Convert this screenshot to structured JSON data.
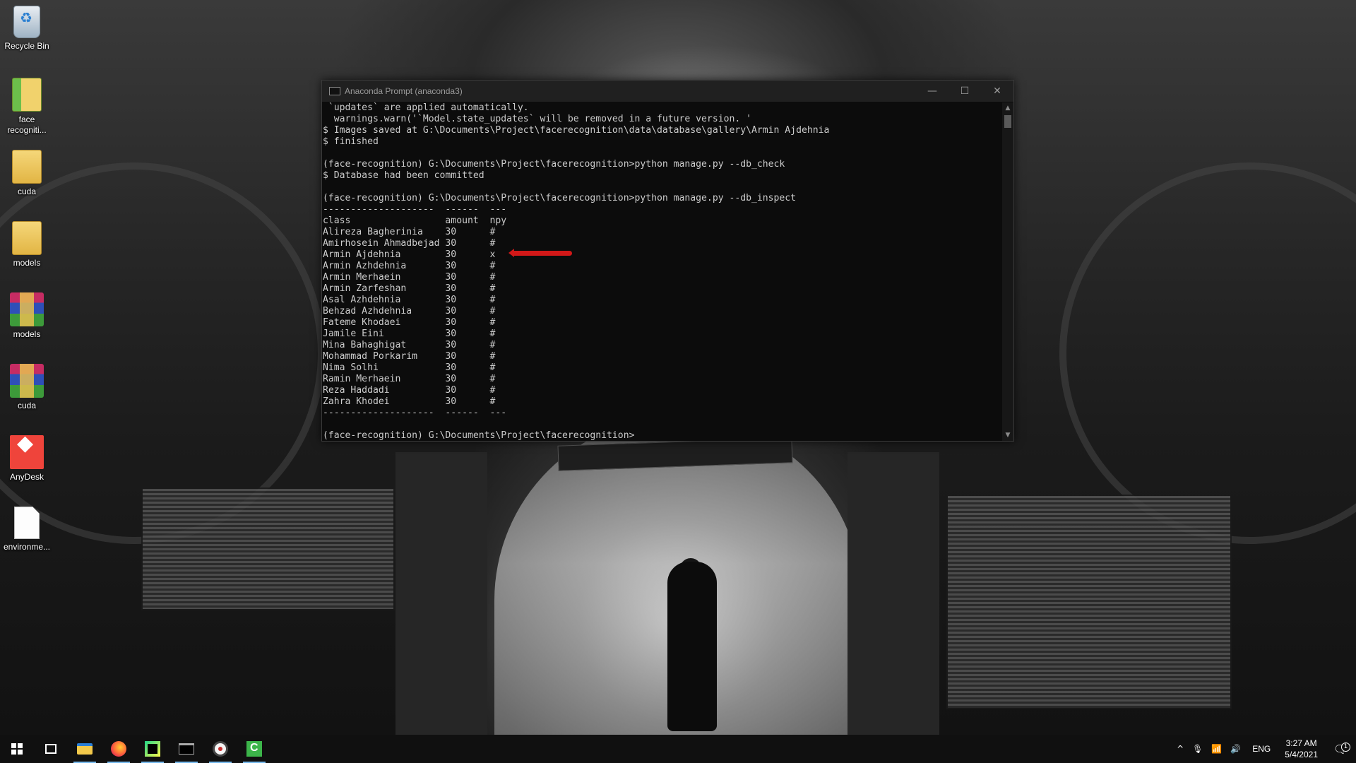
{
  "desktop": {
    "icons": [
      {
        "label": "Recycle Bin",
        "icon": "recycle-bin-icon"
      },
      {
        "label": "face\nrecogniti...",
        "icon": "folder-icon"
      },
      {
        "label": "cuda",
        "icon": "folder-icon"
      },
      {
        "label": "models",
        "icon": "folder-icon"
      },
      {
        "label": "models",
        "icon": "winrar-archive-icon"
      },
      {
        "label": "cuda",
        "icon": "winrar-archive-icon"
      },
      {
        "label": "AnyDesk",
        "icon": "anydesk-icon"
      },
      {
        "label": "environme...",
        "icon": "file-icon"
      }
    ]
  },
  "console": {
    "title": "Anaconda Prompt (anaconda3)",
    "controls": {
      "minimize": "—",
      "maximize": "☐",
      "close": "✕"
    },
    "lines": [
      " `updates` are applied automatically.",
      "  warnings.warn('`Model.state_updates` will be removed in a future version. '",
      "$ Images saved at G:\\Documents\\Project\\facerecognition\\data\\database\\gallery\\Armin Ajdehnia",
      "$ finished",
      "",
      "(face-recognition) G:\\Documents\\Project\\facerecognition>python manage.py --db_check",
      "$ Database had been committed",
      "",
      "(face-recognition) G:\\Documents\\Project\\facerecognition>python manage.py --db_inspect",
      "--------------------  ------  ---",
      "class                 amount  npy",
      "Alireza Bagherinia    30      #",
      "Amirhosein Ahmadbejad 30      #",
      "Armin Ajdehnia        30      x",
      "Armin Azhdehnia       30      #",
      "Armin Merhaein        30      #",
      "Armin Zarfeshan       30      #",
      "Asal Azhdehnia        30      #",
      "Behzad Azhdehnia      30      #",
      "Fateme Khodaei        30      #",
      "Jamile Eini           30      #",
      "Mina Bahaghigat       30      #",
      "Mohammad Porkarim     30      #",
      "Nima Solhi            30      #",
      "Ramin Merhaein        30      #",
      "Reza Haddadi          30      #",
      "Zahra Khodei          30      #",
      "--------------------  ------  ---",
      "",
      "(face-recognition) G:\\Documents\\Project\\facerecognition>"
    ],
    "scroll": {
      "up": "▲",
      "down": "▼"
    }
  },
  "taskbar": {
    "apps": [
      "windows-start-icon",
      "task-view-icon",
      "file-explorer-icon",
      "firefox-icon",
      "pycharm-icon",
      "command-prompt-icon",
      "obs-icon",
      "camtasia-icon"
    ],
    "tray": {
      "chevron": "^",
      "mic": "🎙",
      "network": "📶",
      "volume": "🔊",
      "lang": "ENG",
      "time": "3:27 AM",
      "date": "5/4/2021",
      "notifications": "🗨",
      "notification_count": "1"
    }
  }
}
